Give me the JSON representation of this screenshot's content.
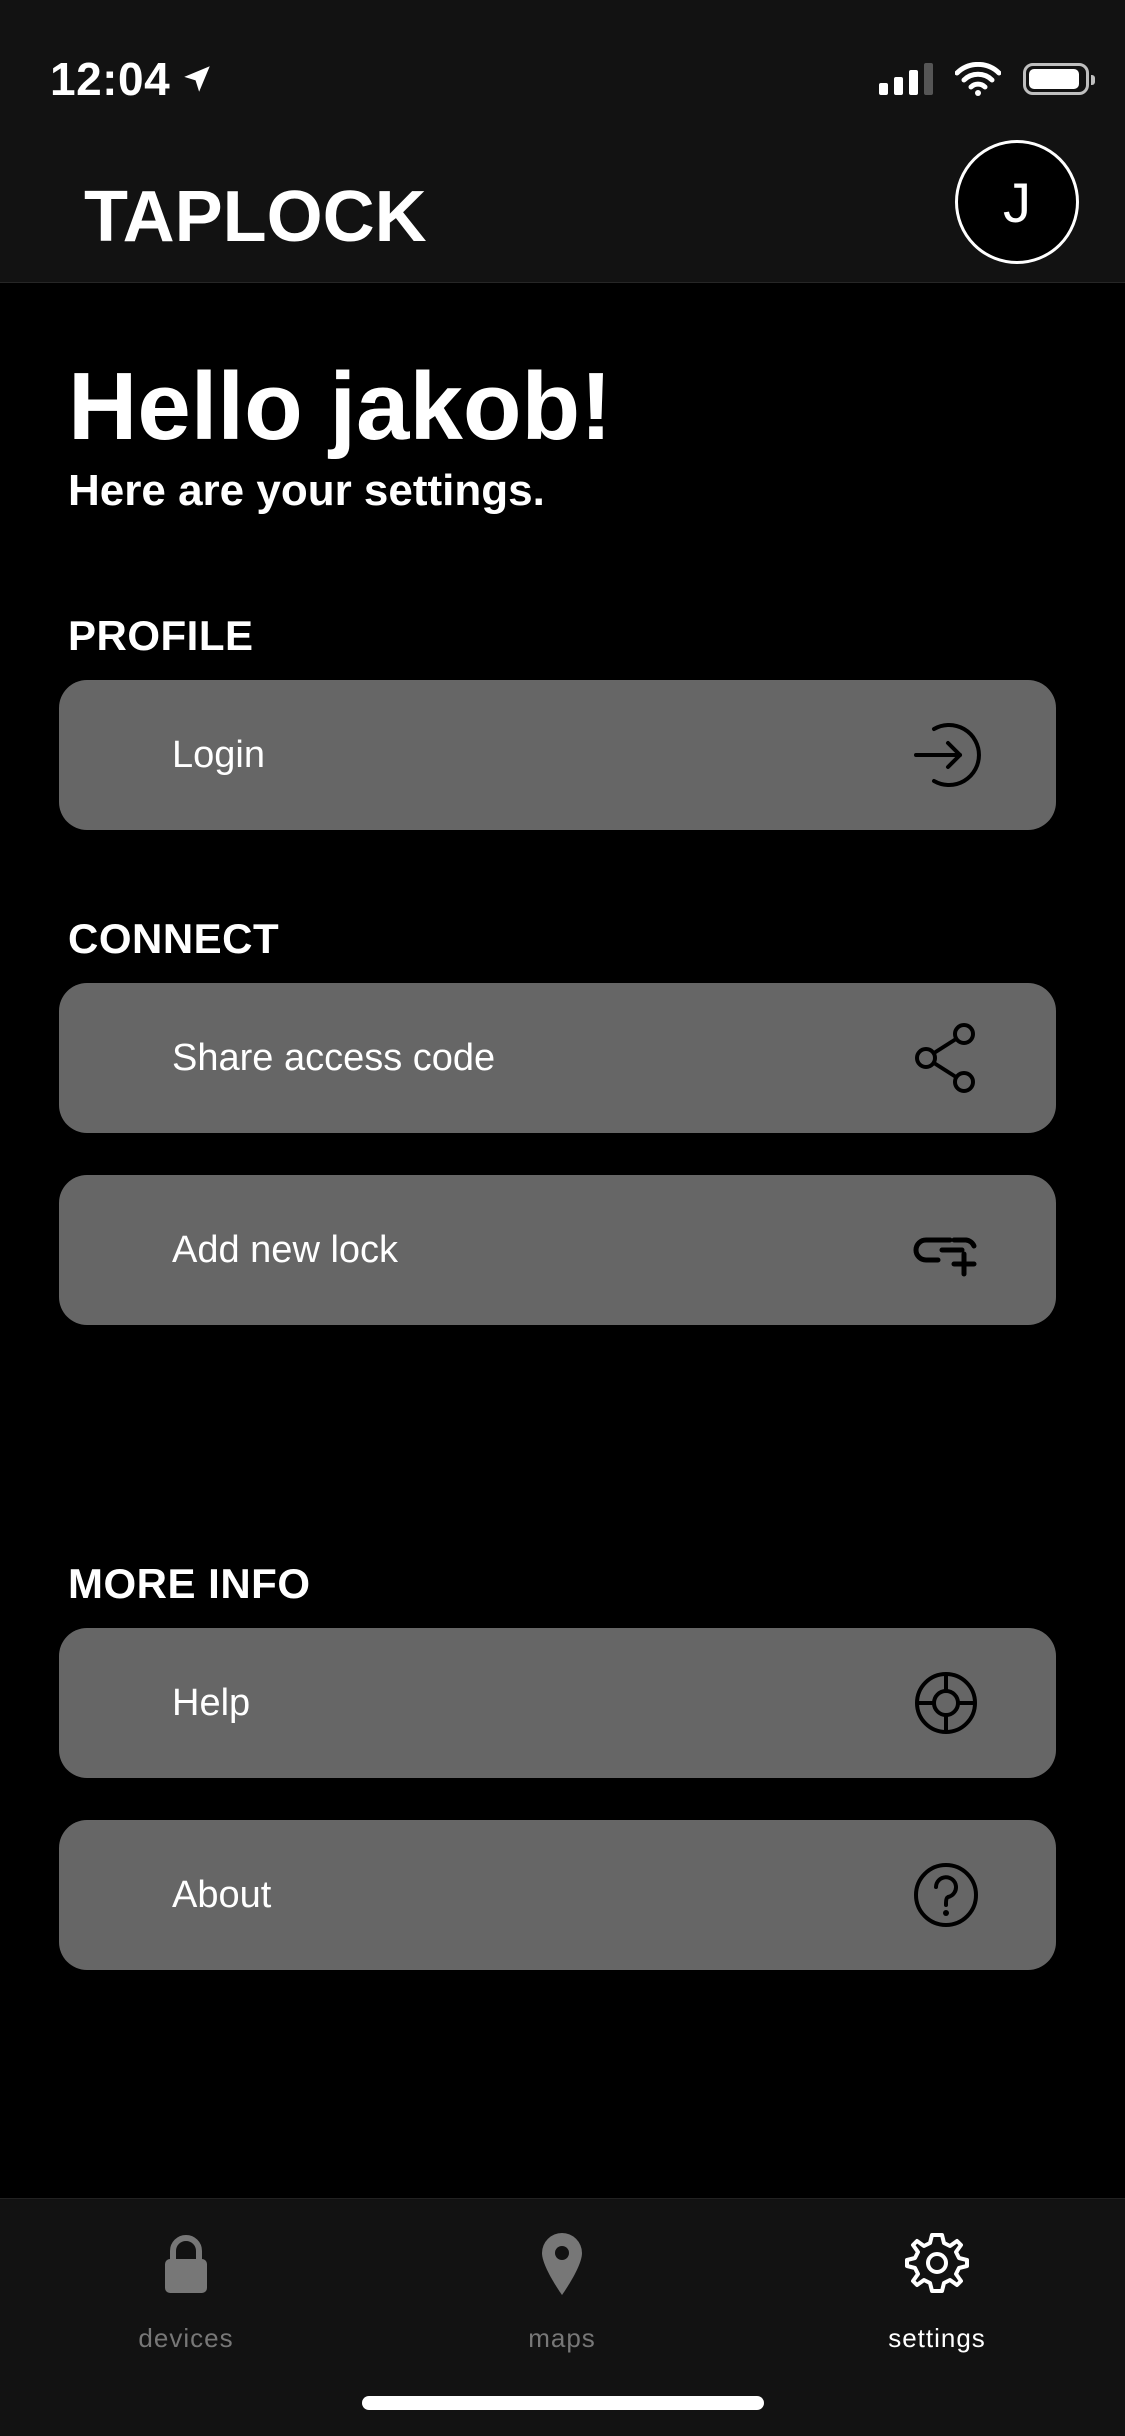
{
  "status_bar": {
    "time": "12:04"
  },
  "header": {
    "app_title": "TAPLOCK",
    "avatar_initial": "J"
  },
  "greeting": {
    "title": "Hello jakob!",
    "subtitle": "Here are your settings."
  },
  "sections": {
    "profile": {
      "title": "PROFILE",
      "items": [
        {
          "label": "Login",
          "icon": "login-arrow-icon"
        }
      ]
    },
    "connect": {
      "title": "CONNECT",
      "items": [
        {
          "label": "Share access code",
          "icon": "share-icon"
        },
        {
          "label": "Add new lock",
          "icon": "add-link-icon"
        }
      ]
    },
    "more_info": {
      "title": "MORE INFO",
      "items": [
        {
          "label": "Help",
          "icon": "lifebuoy-icon"
        },
        {
          "label": "About",
          "icon": "question-icon"
        }
      ]
    }
  },
  "tabbar": {
    "tabs": [
      {
        "label": "devices",
        "icon": "lock-icon",
        "active": false
      },
      {
        "label": "maps",
        "icon": "map-pin-icon",
        "active": false
      },
      {
        "label": "settings",
        "icon": "gear-icon",
        "active": true
      }
    ]
  },
  "colors": {
    "background": "#000000",
    "row_background": "#666666",
    "bar_background": "#121212",
    "inactive_tab": "#777777"
  }
}
